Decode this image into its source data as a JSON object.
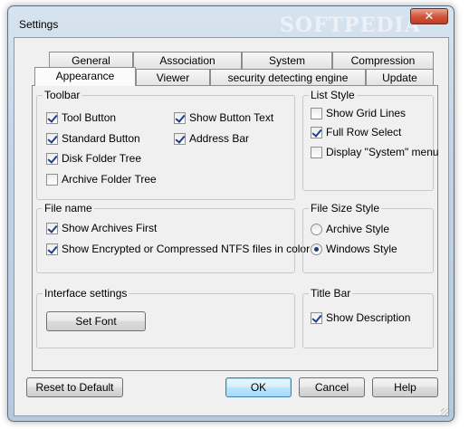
{
  "window": {
    "title": "Settings",
    "watermark": "SOFTPEDIA",
    "close_symbol": "✕"
  },
  "tabs": {
    "back_row": [
      "General",
      "Association",
      "System",
      "Compression"
    ],
    "front_row": [
      "Appearance",
      "Viewer",
      "security detecting engine",
      "Update"
    ],
    "active": "Appearance"
  },
  "toolbar_group": {
    "label": "Toolbar",
    "items": [
      {
        "label": "Tool Button",
        "checked": true
      },
      {
        "label": "Standard Button",
        "checked": true
      },
      {
        "label": "Disk Folder Tree",
        "checked": true
      },
      {
        "label": "Archive Folder Tree",
        "checked": false
      },
      {
        "label": "Show Button Text",
        "checked": true
      },
      {
        "label": "Address Bar",
        "checked": true
      }
    ]
  },
  "list_style_group": {
    "label": "List Style",
    "items": [
      {
        "label": "Show Grid Lines",
        "checked": false
      },
      {
        "label": "Full Row Select",
        "checked": true
      },
      {
        "label": "Display \"System\" menu",
        "checked": false
      }
    ]
  },
  "file_name_group": {
    "label": "File name",
    "items": [
      {
        "label": "Show Archives First",
        "checked": true
      },
      {
        "label": "Show Encrypted or Compressed NTFS files in color",
        "checked": true
      }
    ]
  },
  "file_size_group": {
    "label": "File Size Style",
    "options": [
      {
        "label": "Archive Style",
        "selected": false
      },
      {
        "label": "Windows Style",
        "selected": true
      }
    ]
  },
  "interface_group": {
    "label": "Interface settings",
    "set_font_label": "Set Font"
  },
  "title_bar_group": {
    "label": "Title Bar",
    "items": [
      {
        "label": "Show Description",
        "checked": true
      }
    ]
  },
  "buttons": {
    "reset": "Reset to Default",
    "ok": "OK",
    "cancel": "Cancel",
    "help": "Help"
  }
}
